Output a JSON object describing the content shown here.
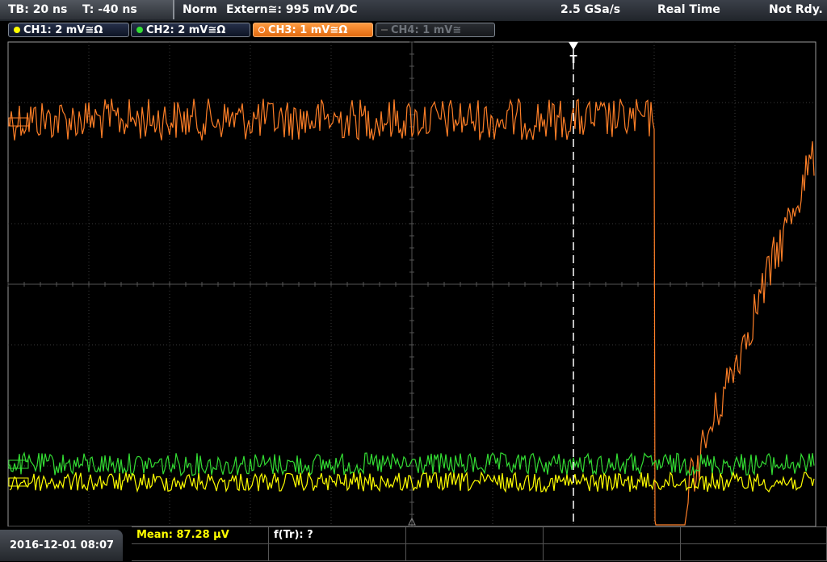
{
  "header": {
    "timebase": "TB: 20 ns",
    "trigger_time": "T: -40 ns",
    "acq_mode": "Norm",
    "trigger_source": "Extern≅: 995 mV ⁄DC",
    "sample_rate": "2.5 GSa/s",
    "mode": "Real Time",
    "status": "Not Rdy."
  },
  "channels": [
    {
      "label": "CH1: 2 mV≅Ω",
      "color": "#ffff00",
      "state": "on"
    },
    {
      "label": "CH2: 2 mV≅Ω",
      "color": "#33dd33",
      "state": "on"
    },
    {
      "label": "CH3: 1 mV≅Ω",
      "color": "#ff7f27",
      "state": "active"
    },
    {
      "label": "CH4: 1 mV≅",
      "color": "#777777",
      "state": "off"
    }
  ],
  "trigger_marker": "T",
  "footer": {
    "datetime": "2016-12-01 08:07",
    "measurements": [
      {
        "label": "Mean: 87.28 µV",
        "color": "#ffff00"
      },
      {
        "label": "f(Tr): ?",
        "color": "#ffffff"
      }
    ]
  },
  "colors": {
    "grid": "#3a3a3a",
    "ch1": "#ffff00",
    "ch2": "#33dd33",
    "ch3": "#ff7f27"
  }
}
